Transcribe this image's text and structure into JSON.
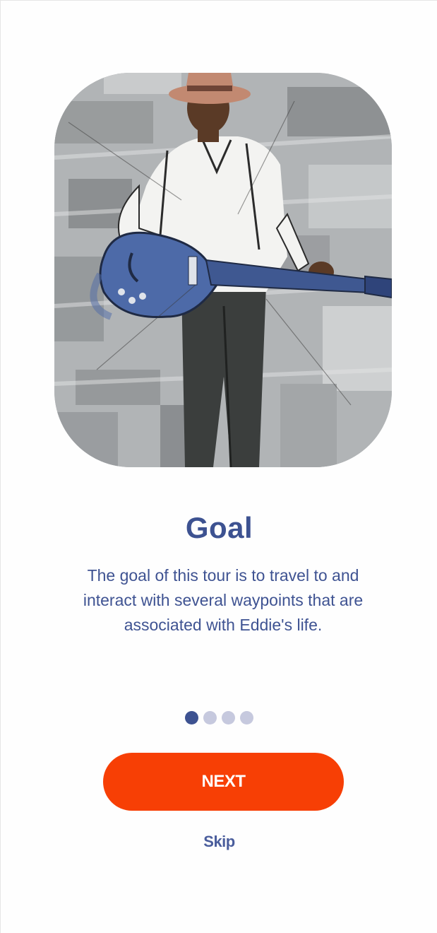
{
  "onboarding": {
    "illustration": {
      "icon": "blues-guitarist-illustration",
      "palette": {
        "background": "#b3b6b8",
        "guitar": "#4d6aa8",
        "shirt": "#f4f4f2",
        "pants": "#3a3d3c",
        "hat": "#c48a72",
        "skin": "#5a3a26"
      }
    },
    "title": "Goal",
    "description": "The goal of this tour is to travel to and interact with several waypoints that are associated with Eddie's life.",
    "pager": {
      "total": 4,
      "current": 1,
      "active_color": "#3d5291",
      "inactive_color": "#c6c9de"
    },
    "next_label": "NEXT",
    "skip_label": "Skip",
    "colors": {
      "accent": "#f73f05",
      "text": "#3d5291"
    }
  }
}
